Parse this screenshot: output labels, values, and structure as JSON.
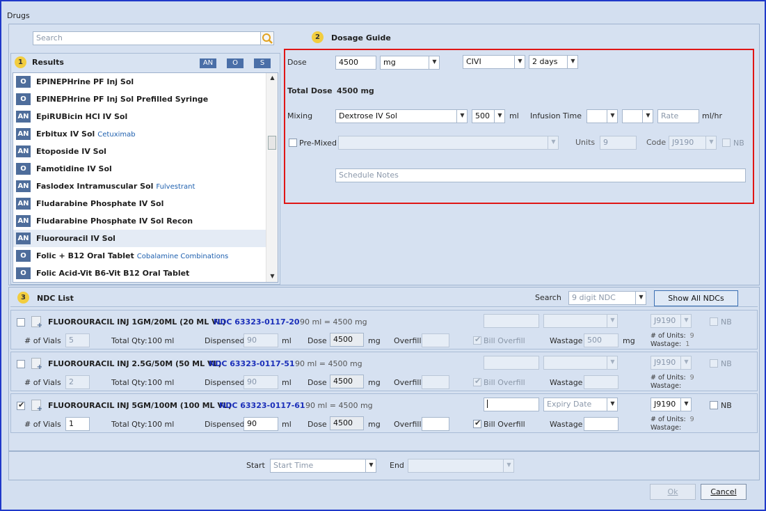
{
  "window": {
    "title": "Drugs"
  },
  "search": {
    "placeholder": "Search"
  },
  "results": {
    "step": "1",
    "title": "Results",
    "filters": [
      "AN",
      "O",
      "S"
    ],
    "items": [
      {
        "badge": "O",
        "name": "EPINEPHrine PF Inj Sol",
        "generic": ""
      },
      {
        "badge": "O",
        "name": "EPINEPHrine PF Inj Sol Prefilled Syringe",
        "generic": ""
      },
      {
        "badge": "AN",
        "name": "EpiRUBicin HCl IV Sol",
        "generic": ""
      },
      {
        "badge": "AN",
        "name": "Erbitux IV Sol",
        "generic": "Cetuximab"
      },
      {
        "badge": "AN",
        "name": "Etoposide IV Sol",
        "generic": ""
      },
      {
        "badge": "O",
        "name": "Famotidine IV Sol",
        "generic": ""
      },
      {
        "badge": "AN",
        "name": "Faslodex Intramuscular Sol",
        "generic": "Fulvestrant"
      },
      {
        "badge": "AN",
        "name": "Fludarabine Phosphate IV Sol",
        "generic": ""
      },
      {
        "badge": "AN",
        "name": "Fludarabine Phosphate IV Sol Recon",
        "generic": ""
      },
      {
        "badge": "AN",
        "name": "Fluorouracil IV Sol",
        "generic": ""
      },
      {
        "badge": "O",
        "name": "Folic + B12 Oral Tablet",
        "generic": "Cobalamine Combinations"
      },
      {
        "badge": "O",
        "name": "Folic Acid-Vit B6-Vit B12 Oral Tablet",
        "generic": ""
      }
    ]
  },
  "dosage": {
    "step": "2",
    "title": "Dosage Guide",
    "dose_label": "Dose",
    "dose_value": "4500",
    "dose_unit": "mg",
    "route": "CIVI",
    "duration": "2 days",
    "total_label": "Total Dose",
    "total_value": "4500 mg",
    "mixing_label": "Mixing",
    "mixing_value": "Dextrose IV Sol",
    "mixing_volume": "500",
    "ml": "ml",
    "infusion_label": "Infusion Time",
    "rate_placeholder": "Rate",
    "rate_unit": "ml/hr",
    "premixed_label": "Pre-Mixed",
    "units_label": "Units",
    "units_value": "9",
    "code_label": "Code",
    "code_value": "J9190",
    "nb_label": "NB",
    "notes_placeholder": "Schedule Notes"
  },
  "ndc": {
    "step": "3",
    "title": "NDC List",
    "search_label": "Search",
    "search_placeholder": "9 digit NDC",
    "show_all": "Show All NDCs",
    "labels": {
      "vials": "# of Vials",
      "total": "Total Qty:",
      "dispensed": "Dispensed",
      "ml": "ml",
      "dose": "Dose",
      "mg": "mg",
      "overfill": "Overfill",
      "bill_overfill": "Bill Overfill",
      "wastage": "Wastage",
      "units": "# of Units:",
      "wastage_small": "Wastage:",
      "nb": "NB",
      "expiry": "Expiry Date"
    },
    "rows": [
      {
        "name": "FLUOROURACIL INJ 1GM/20ML (20 ML VL)",
        "code": "NDC 63323-0117-20",
        "equiv": "90 ml = 4500 mg",
        "vials": "5",
        "total_qty": "100 ml",
        "dispensed": "90",
        "dose": "4500",
        "wastage": "500",
        "wastage_unit": "mg",
        "hcpcs": "J9190",
        "units": "9",
        "wastage_count": "1",
        "checked": false
      },
      {
        "name": "FLUOROURACIL INJ 2.5G/50M (50 ML VL)",
        "code": "NDC 63323-0117-51",
        "equiv": "90 ml = 4500 mg",
        "vials": "2",
        "total_qty": "100 ml",
        "dispensed": "90",
        "dose": "4500",
        "wastage": "",
        "wastage_unit": "",
        "hcpcs": "J9190",
        "units": "9",
        "wastage_count": "",
        "checked": false
      },
      {
        "name": "FLUOROURACIL INJ 5GM/100M (100 ML VL)",
        "code": "NDC 63323-0117-61",
        "equiv": "90 ml = 4500 mg",
        "vials": "1",
        "total_qty": "100 ml",
        "dispensed": "90",
        "dose": "4500",
        "wastage": "",
        "wastage_unit": "",
        "hcpcs": "J9190",
        "units": "9",
        "wastage_count": "",
        "checked": true
      }
    ]
  },
  "schedule": {
    "start_label": "Start",
    "start_placeholder": "Start Time",
    "end_label": "End"
  },
  "buttons": {
    "ok": "Ok",
    "cancel": "Cancel"
  }
}
